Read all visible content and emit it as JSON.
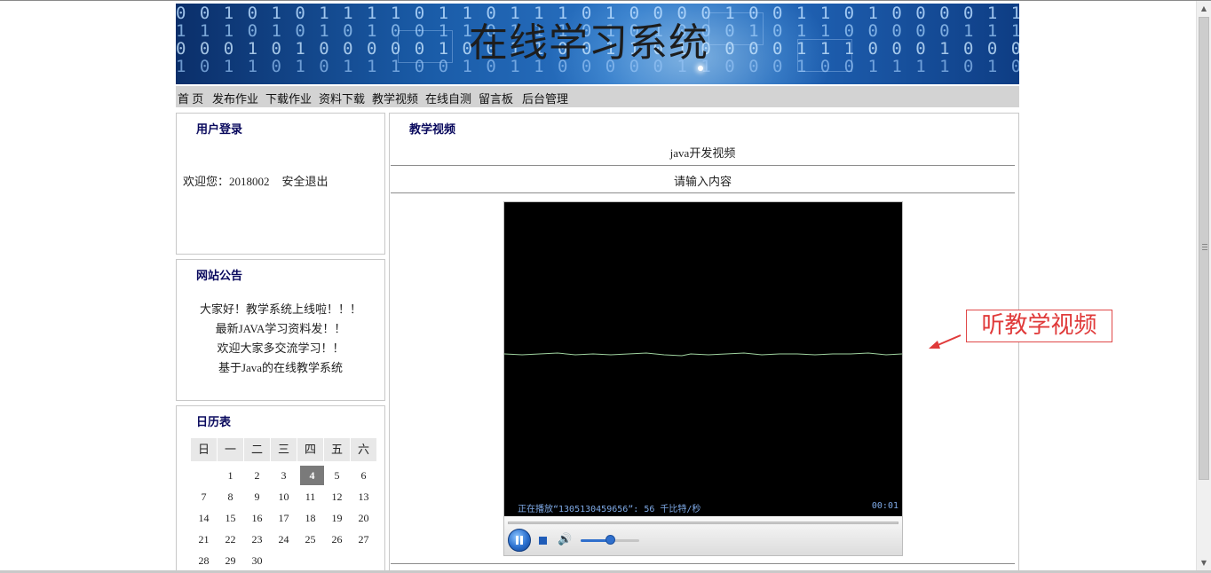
{
  "site": {
    "title": "在线学习系统",
    "binary_rows": [
      "0 0 1 0 1 0 1 1 1 1 0 1 1 0 1 1 1 0 1 0 0 0 0 1 0 0 1 1 0 1   0 0 0 0 1 1 1 0 0 0 0 0",
      "1 1 1 0 1 0 1 0 1 0 0 1 1 0 1 1 1 0 1 0 1 0 0 0 1 0 1 1 0 0   0 0 0 1 1 1 0 0 1 0 1 0 1",
      "0 0 0 1   0 1 0 0 0 0 0 1 0 0 1 1 0 0 1 1 0 1 0 0 0 0 1 1 1   0 0 0 1 0 0 0 1 0 0 0 1 1",
      "1 0   1 1 0 1 0 1 1 1 0 0 1 0 1 1 0 0 0 0 0 1 1 0 0 0 1 0 0   1 1 1 1 0 1 0 0 0 1 0 0 0"
    ]
  },
  "nav": {
    "items": [
      "首 页",
      "发布作业",
      "下载作业",
      "资料下载",
      "教学视频",
      "在线自测",
      "留言板",
      "后台管理"
    ]
  },
  "login": {
    "title": "用户登录",
    "welcome": "欢迎您：2018002",
    "logout": "安全退出"
  },
  "notice": {
    "title": "网站公告",
    "lines": [
      "大家好！教学系统上线啦！！！",
      "最新JAVA学习资料发！！",
      "欢迎大家多交流学习！！",
      "基于Java的在线教学系统"
    ]
  },
  "calendar": {
    "title": "日历表",
    "weekdays": [
      "日",
      "一",
      "二",
      "三",
      "四",
      "五",
      "六"
    ],
    "weeks": [
      [
        "",
        "1",
        "2",
        "3",
        "4",
        "5",
        "6"
      ],
      [
        "7",
        "8",
        "9",
        "10",
        "11",
        "12",
        "13"
      ],
      [
        "14",
        "15",
        "16",
        "17",
        "18",
        "19",
        "20"
      ],
      [
        "21",
        "22",
        "23",
        "24",
        "25",
        "26",
        "27"
      ],
      [
        "28",
        "29",
        "30",
        "",
        "",
        "",
        ""
      ]
    ],
    "today": "4"
  },
  "main": {
    "title": "教学视频",
    "video_title": "java开发视频",
    "video_desc": "请输入内容"
  },
  "player": {
    "status": "正在播放“1305130459656”: 56 千比特/秒",
    "time": "00:01",
    "volume": 0.5,
    "colors": {
      "waveform": "#9fd39f",
      "status": "#7ea9e6"
    }
  },
  "annotation": {
    "text": "听教学视频",
    "color": "#e03a3a"
  }
}
